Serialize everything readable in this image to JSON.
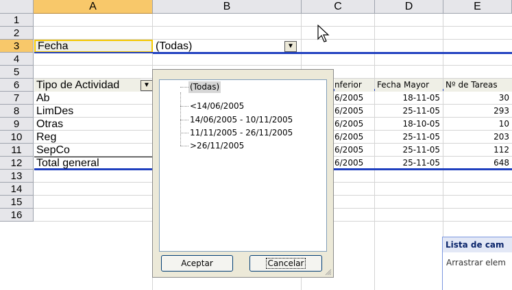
{
  "columns": [
    "A",
    "B",
    "C",
    "D",
    "E"
  ],
  "rows": [
    "1",
    "2",
    "3",
    "4",
    "5",
    "6",
    "7",
    "8",
    "9",
    "10",
    "11",
    "12",
    "13",
    "14",
    "15",
    "16"
  ],
  "page_field": {
    "label": "Fecha",
    "value": "(Todas)"
  },
  "row_field": {
    "label": "Tipo de Actividad"
  },
  "table_headers": {
    "c": "nferior",
    "d": "Fecha Mayor",
    "e": "Nº de Tareas"
  },
  "table_rows": [
    {
      "a": "Ab",
      "c": "6/2005",
      "d": "18-11-05",
      "e": "30"
    },
    {
      "a": "LimDes",
      "c": "6/2005",
      "d": "25-11-05",
      "e": "293"
    },
    {
      "a": "Otras",
      "c": "6/2005",
      "d": "18-10-05",
      "e": "10"
    },
    {
      "a": "Reg",
      "c": "6/2005",
      "d": "25-11-05",
      "e": "203"
    },
    {
      "a": "SepCo",
      "c": "6/2005",
      "d": "25-11-05",
      "e": "112"
    },
    {
      "a": "Total general",
      "c": "6/2005",
      "d": "25-11-05",
      "e": "648"
    }
  ],
  "dropdown": {
    "items": [
      "(Todas)",
      "<14/06/2005",
      "14/06/2005 - 10/11/2005",
      "11/11/2005 - 26/11/2005",
      ">26/11/2005"
    ],
    "ok_label": "Aceptar",
    "cancel_label": "Cancelar"
  },
  "field_list": {
    "title": "Lista de cam",
    "description": "Arrastrar elem"
  },
  "colors": {
    "accent_line": "#1f3fbf",
    "header_selected": "#f8c86a",
    "header_bg": "#e6e6ea"
  }
}
